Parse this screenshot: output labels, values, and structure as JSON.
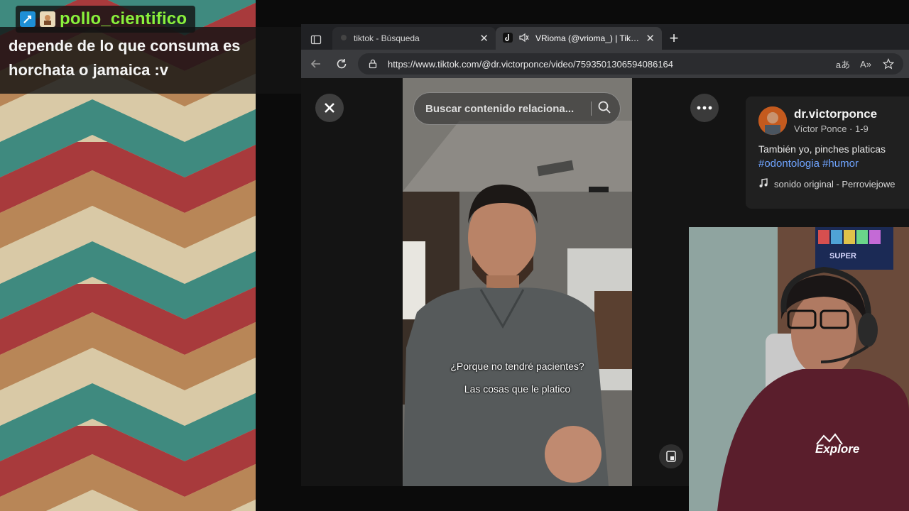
{
  "chat": {
    "username": "pollo_cientifico",
    "message": "depende de lo que consuma es horchata o jamaica :v",
    "badges": [
      "tool-badge-icon",
      "avatar-badge-icon"
    ],
    "username_color": "#8af23c"
  },
  "browser": {
    "tabs": [
      {
        "title": "tiktok - Búsqueda",
        "active": false
      },
      {
        "title": "VRioma (@vrioma_) | TikTok",
        "active": true
      }
    ],
    "url": "https://www.tiktok.com/@dr.victorponce/video/7593501306594086164"
  },
  "video": {
    "search_placeholder": "Buscar contenido relaciona...",
    "caption_line1": "¿Porque no tendré pacientes?",
    "caption_line2": "Las cosas que le platico"
  },
  "creator": {
    "handle": "dr.victorponce",
    "subtitle": "Víctor Ponce · 1-9",
    "description": "También yo, pinches platicas",
    "tags": "#odontologia #humor",
    "sound": "sonido original - Perroviejowe"
  },
  "webcam": {
    "shirt_text": "Explore",
    "poster_text": "SUPER"
  },
  "colors": {
    "accent_link": "#6fa4ff",
    "chevron_teal": "#3f8a7f",
    "chevron_red": "#a83a3c",
    "chevron_tan": "#b88657",
    "chevron_cream": "#d9c9a6"
  }
}
